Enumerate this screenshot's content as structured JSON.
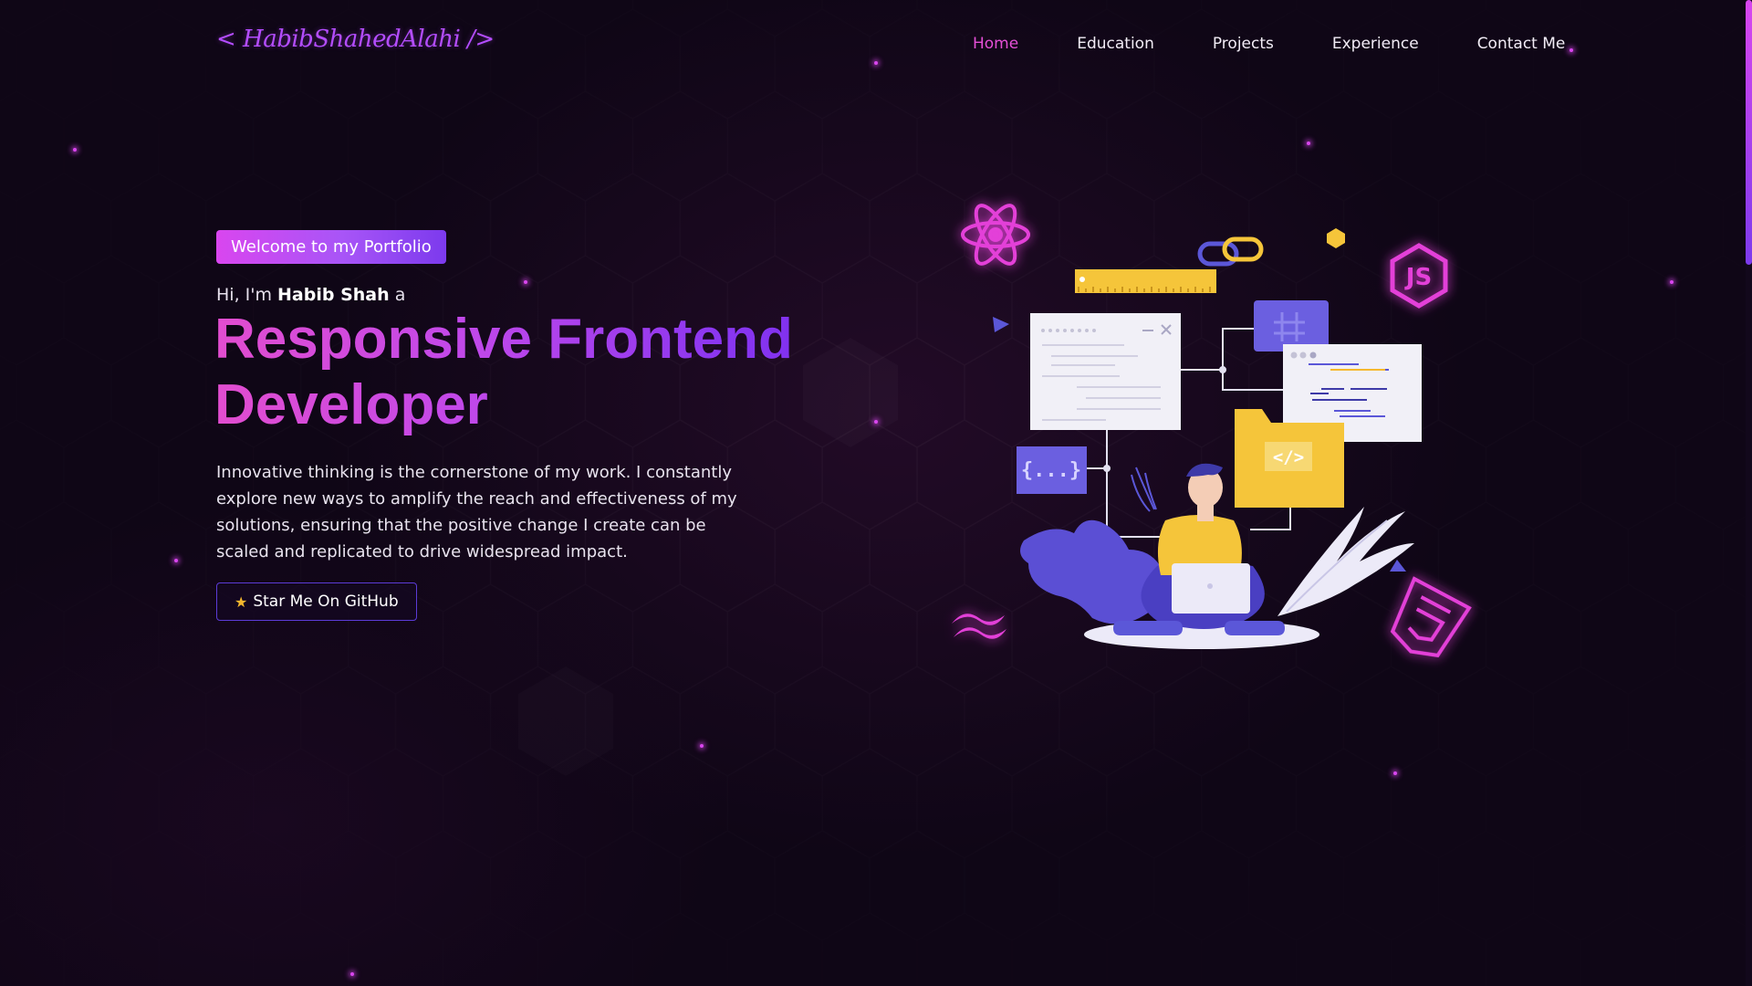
{
  "header": {
    "logo": "< HabibShahedAlahi />",
    "nav": [
      {
        "label": "Home",
        "active": true
      },
      {
        "label": "Education",
        "active": false
      },
      {
        "label": "Projects",
        "active": false
      },
      {
        "label": "Experience",
        "active": false
      },
      {
        "label": "Contact Me",
        "active": false
      }
    ]
  },
  "hero": {
    "badge": "Welcome to my Portfolio",
    "greeting_prefix": "Hi, I'm",
    "name": "Habib Shah",
    "greeting_suffix": "a",
    "headline_line1": "Responsive Frontend",
    "headline_line2": "Developer",
    "description": "Innovative thinking is the cornerstone of my work. I constantly explore new ways to amplify the reach and effectiveness of my solutions, ensuring that the positive change I create can be scaled and replicated to drive widespread impact.",
    "cta_label": "Star Me On GitHub",
    "cta_icon": "star-icon"
  },
  "illustration": {
    "icons": [
      "react-icon",
      "nodejs-icon",
      "tailwind-icon",
      "html5-icon",
      "code-folder-icon",
      "braces-icon",
      "hashtag-icon",
      "link-icon"
    ],
    "folder_code": "</>",
    "braces_text": "{...}"
  },
  "colors": {
    "background": "#0f0616",
    "accent_pink": "#e44fd6",
    "accent_purple": "#7c3aed",
    "star_yellow": "#f5b82e"
  }
}
